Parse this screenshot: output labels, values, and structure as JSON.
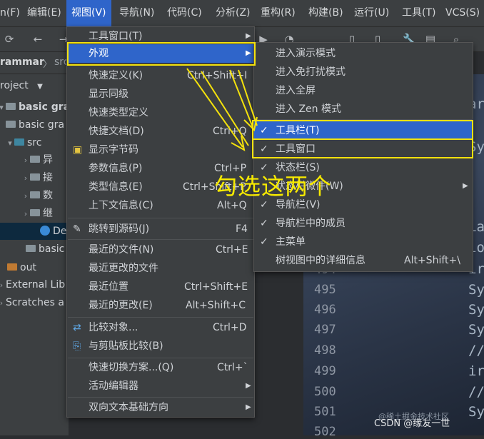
{
  "menubar": {
    "items": [
      "n(F)",
      "编辑(E)",
      "视图(V)",
      "导航(N)",
      "代码(C)",
      "分析(Z)",
      "重构(R)",
      "构建(B)",
      "运行(U)",
      "工具(T)",
      "VCS(S)"
    ]
  },
  "navbar": {
    "root": "rammar",
    "child": "src"
  },
  "project": {
    "header": "roject",
    "rows": [
      {
        "label": "basic gram",
        "bold": true
      },
      {
        "label": "basic gra"
      },
      {
        "label": "src"
      },
      {
        "label": "异"
      },
      {
        "label": "接"
      },
      {
        "label": "数"
      },
      {
        "label": "继"
      },
      {
        "label": "De"
      },
      {
        "label": "basic"
      },
      {
        "label": "out"
      },
      {
        "label": "External Lib"
      },
      {
        "label": "Scratches a"
      }
    ]
  },
  "menu_view": {
    "items": [
      {
        "label": "工具窗口(T)",
        "shortcut": "",
        "submenu": true
      },
      {
        "label": "外观",
        "shortcut": "",
        "submenu": true,
        "highlighted": true
      },
      {
        "label": "快速定义(K)",
        "shortcut": "Ctrl+Shift+I"
      },
      {
        "label": "显示同级",
        "shortcut": ""
      },
      {
        "label": "快速类型定义",
        "shortcut": ""
      },
      {
        "label": "快捷文档(D)",
        "shortcut": "Ctrl+Q"
      },
      {
        "label": "显示字节码",
        "shortcut": ""
      },
      {
        "label": "参数信息(P)",
        "shortcut": "Ctrl+P"
      },
      {
        "label": "类型信息(E)",
        "shortcut": "Ctrl+Shift+P"
      },
      {
        "label": "上下文信息(C)",
        "shortcut": "Alt+Q"
      },
      {
        "label": "跳转到源码(J)",
        "shortcut": "F4"
      },
      {
        "label": "最近的文件(N)",
        "shortcut": "Ctrl+E"
      },
      {
        "label": "最近更改的文件",
        "shortcut": ""
      },
      {
        "label": "最近位置",
        "shortcut": "Ctrl+Shift+E"
      },
      {
        "label": "最近的更改(E)",
        "shortcut": "Alt+Shift+C"
      },
      {
        "label": "比较对象...",
        "shortcut": "Ctrl+D"
      },
      {
        "label": "与剪贴板比较(B)",
        "shortcut": ""
      },
      {
        "label": "快速切换方案...(Q)",
        "shortcut": "Ctrl+`"
      },
      {
        "label": "活动编辑器",
        "shortcut": "",
        "submenu": true
      },
      {
        "label": "双向文本基础方向",
        "shortcut": "",
        "submenu": true
      }
    ]
  },
  "menu_appearance": {
    "items": [
      {
        "label": "进入演示模式",
        "checked": false
      },
      {
        "label": "进入免打扰模式",
        "checked": false
      },
      {
        "label": "进入全屏",
        "checked": false
      },
      {
        "label": "进入 Zen 模式",
        "checked": false
      },
      {
        "label": "工具栏(T)",
        "checked": true,
        "highlighted": true
      },
      {
        "label": "工具窗口",
        "checked": true
      },
      {
        "label": "状态栏(S)",
        "checked": true
      },
      {
        "label": "状态栏微件(W)",
        "checked": false,
        "submenu": true
      },
      {
        "label": "导航栏(V)",
        "checked": true
      },
      {
        "label": "导航栏中的成员",
        "checked": true
      },
      {
        "label": "主菜单",
        "checked": true
      },
      {
        "label": "树视图中的详细信息",
        "checked": false,
        "shortcut": "Alt+Shift+\\"
      }
    ]
  },
  "editor": {
    "line_numbers": [
      "494",
      "495",
      "496",
      "497",
      "498",
      "499",
      "500",
      "501",
      "502"
    ],
    "code_fragments": [
      "ar",
      "Sy",
      "La",
      "io",
      "ir",
      "Sy",
      "Sy",
      "Sy",
      "//",
      "ir",
      "//",
      "Sy"
    ]
  },
  "annotation": {
    "text": "勾选这两个",
    "color": "#f7ea00"
  },
  "watermark": {
    "text": "CSDN @缘友一世",
    "sub": "@稀土掘金技术社区"
  },
  "colors": {
    "highlight": "#2f65ca",
    "menu_bg": "#3c3f41",
    "annotation": "#f4e20c"
  }
}
